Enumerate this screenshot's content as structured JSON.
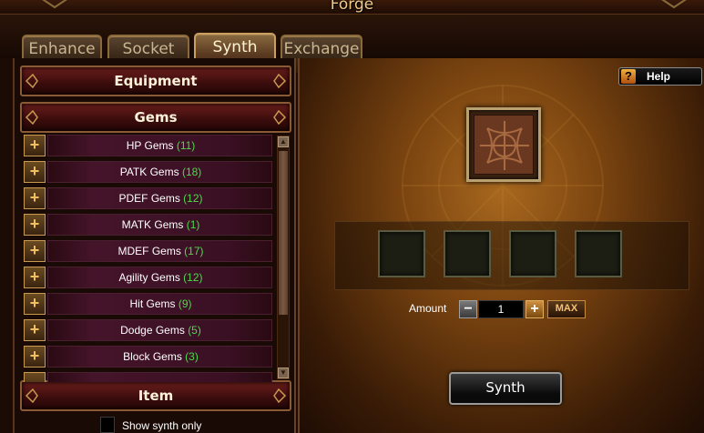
{
  "window": {
    "title": "Forge"
  },
  "tabs": [
    {
      "label": "Enhance",
      "active": false
    },
    {
      "label": "Socket",
      "active": false
    },
    {
      "label": "Synth",
      "active": true
    },
    {
      "label": "Exchange",
      "active": false
    }
  ],
  "left_panel": {
    "categories": {
      "equipment": "Equipment",
      "gems": "Gems",
      "item": "Item"
    },
    "gems": [
      {
        "name": "HP Gems",
        "count": "(11)"
      },
      {
        "name": "PATK Gems",
        "count": "(18)"
      },
      {
        "name": "PDEF Gems",
        "count": "(12)"
      },
      {
        "name": "MATK Gems",
        "count": "(1)"
      },
      {
        "name": "MDEF Gems",
        "count": "(17)"
      },
      {
        "name": "Agility Gems",
        "count": "(12)"
      },
      {
        "name": "Hit Gems",
        "count": "(9)"
      },
      {
        "name": "Dodge Gems",
        "count": "(5)"
      },
      {
        "name": "Block Gems",
        "count": "(3)"
      }
    ],
    "expand_symbol": "+",
    "show_synth_only_label": "Show synth only",
    "scroll_up_symbol": "▲",
    "scroll_down_symbol": "▼"
  },
  "right_panel": {
    "help": {
      "icon": "?",
      "label": "Help"
    },
    "amount": {
      "label": "Amount",
      "value": "1",
      "minus": "−",
      "plus": "+",
      "max": "MAX"
    },
    "synth_button": "Synth"
  },
  "colors": {
    "gem_count": "#4fd84a",
    "header_red": "#6a1e1c",
    "gold_border": "#c89a50",
    "accent_orange": "#f3c98a"
  }
}
